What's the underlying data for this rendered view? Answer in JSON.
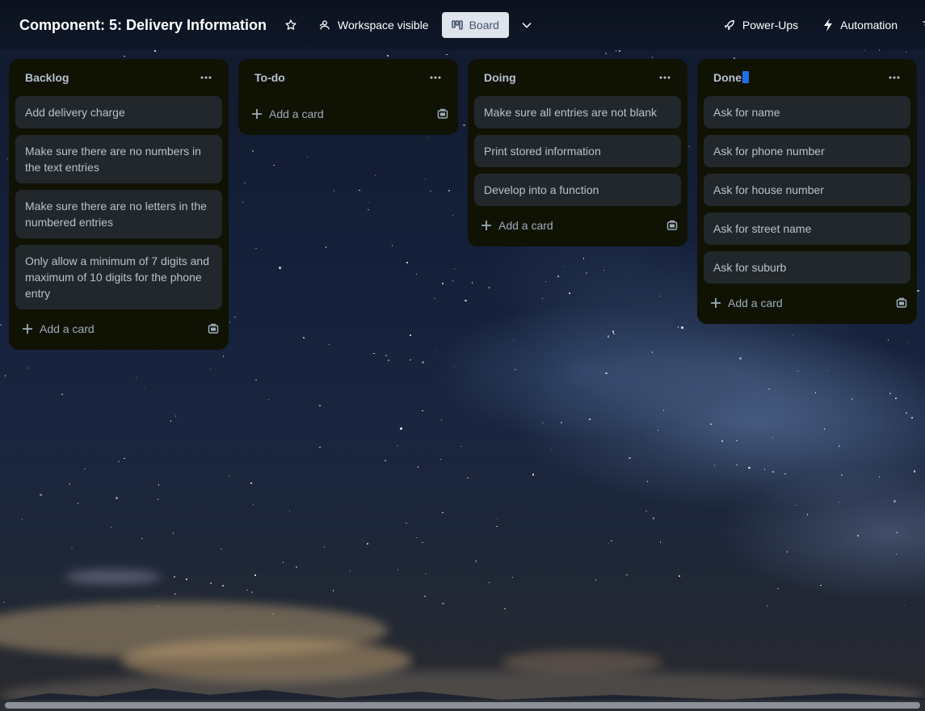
{
  "board": {
    "title": "Component: 5: Delivery Information"
  },
  "header": {
    "workspace_label": "Workspace visible",
    "board_view_label": "Board",
    "powerups_label": "Power-Ups",
    "automation_label": "Automation",
    "icons": [
      "star-icon",
      "workspace-icon",
      "board-icon",
      "chevron-down-icon",
      "rocket-icon",
      "lightning-icon",
      "filter-icon"
    ]
  },
  "lists": [
    {
      "title": "Backlog",
      "cards": [
        "Add delivery charge",
        "Make sure there are no numbers in the text entries",
        "Make sure there are no letters in the numbered entries",
        "Only allow a minimum of 7 digits and maximum of 10 digits for the phone entry"
      ],
      "add_label": "Add a card"
    },
    {
      "title": "To-do",
      "cards": [],
      "add_label": "Add a card"
    },
    {
      "title": "Doing",
      "cards": [
        "Make sure all entries are not blank",
        "Print stored information",
        "Develop into a function"
      ],
      "add_label": "Add a card"
    },
    {
      "title": "Done",
      "cards": [
        "Ask for name",
        "Ask for phone number",
        "Ask for house number",
        "Ask for street name",
        "Ask for suburb"
      ],
      "add_label": "Add a card"
    }
  ],
  "colors": {
    "list_bg": "#101204",
    "card_bg": "#22272b",
    "text": "#b6c2cf",
    "board_button_bg": "#dfe4ec"
  }
}
